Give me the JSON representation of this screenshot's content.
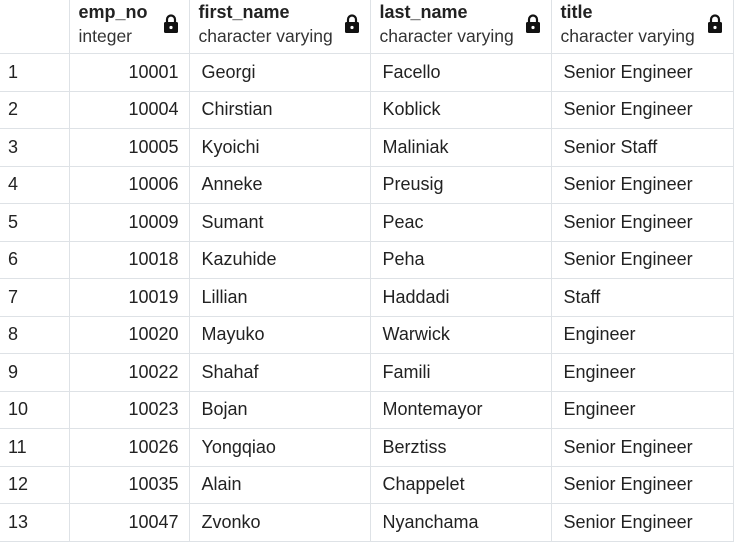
{
  "columns": [
    {
      "name": "emp_no",
      "type": "integer",
      "icon": "lock-icon"
    },
    {
      "name": "first_name",
      "type": "character varying",
      "icon": "lock-icon"
    },
    {
      "name": "last_name",
      "type": "character varying",
      "icon": "lock-icon"
    },
    {
      "name": "title",
      "type": "character varying",
      "icon": "lock-icon"
    }
  ],
  "rows": [
    [
      "1",
      "10001",
      "Georgi",
      "Facello",
      "Senior Engineer"
    ],
    [
      "2",
      "10004",
      "Chirstian",
      "Koblick",
      "Senior Engineer"
    ],
    [
      "3",
      "10005",
      "Kyoichi",
      "Maliniak",
      "Senior Staff"
    ],
    [
      "4",
      "10006",
      "Anneke",
      "Preusig",
      "Senior Engineer"
    ],
    [
      "5",
      "10009",
      "Sumant",
      "Peac",
      "Senior Engineer"
    ],
    [
      "6",
      "10018",
      "Kazuhide",
      "Peha",
      "Senior Engineer"
    ],
    [
      "7",
      "10019",
      "Lillian",
      "Haddadi",
      "Staff"
    ],
    [
      "8",
      "10020",
      "Mayuko",
      "Warwick",
      "Engineer"
    ],
    [
      "9",
      "10022",
      "Shahaf",
      "Famili",
      "Engineer"
    ],
    [
      "10",
      "10023",
      "Bojan",
      "Montemayor",
      "Engineer"
    ],
    [
      "11",
      "10026",
      "Yongqiao",
      "Berztiss",
      "Senior Engineer"
    ],
    [
      "12",
      "10035",
      "Alain",
      "Chappelet",
      "Senior Engineer"
    ],
    [
      "13",
      "10047",
      "Zvonko",
      "Nyanchama",
      "Senior Engineer"
    ]
  ]
}
